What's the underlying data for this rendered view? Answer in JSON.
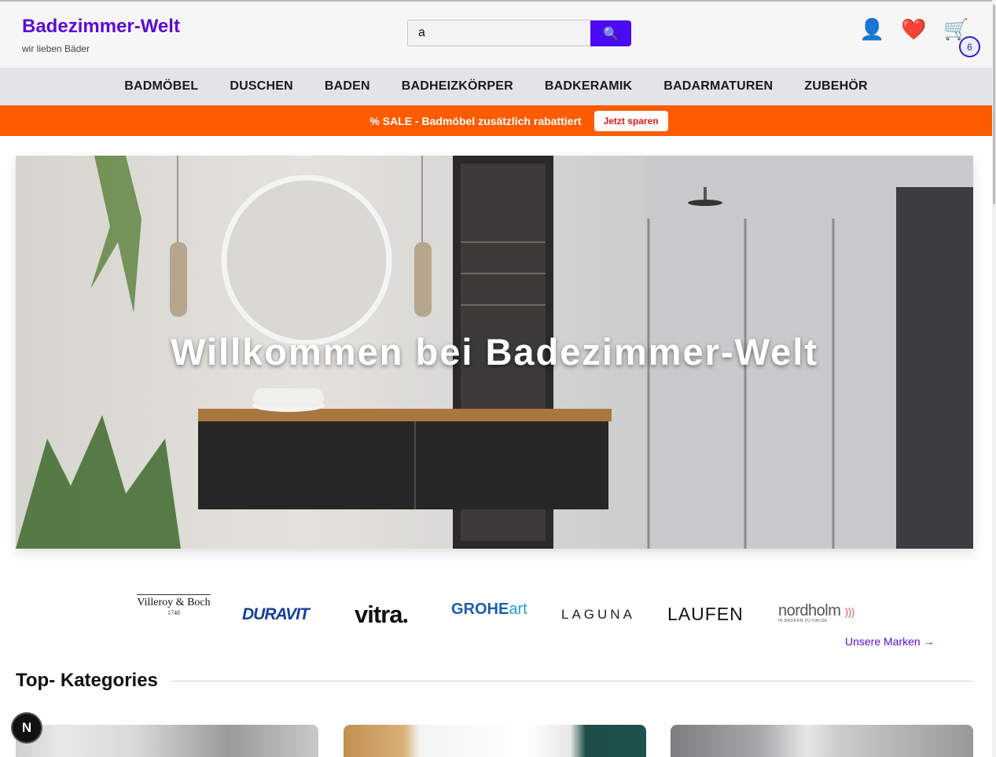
{
  "header": {
    "logo": "Badezimmer-Welt",
    "tagline": "wir lieben Bäder",
    "search_value": "a",
    "search_icon": "🔍",
    "user_icon": "👤",
    "wishlist_icon": "❤️",
    "cart_icon": "🛒",
    "cart_count": "6"
  },
  "nav": {
    "items": [
      "BADMÖBEL",
      "DUSCHEN",
      "BADEN",
      "BADHEIZKÖRPER",
      "BADKERAMIK",
      "BADARMATUREN",
      "ZUBEHÖR"
    ]
  },
  "sale": {
    "text": "% SALE - Badmöbel zusätzlich rabattiert",
    "button": "Jetzt sparen"
  },
  "hero": {
    "title": "Willkommen bei Badezimmer-Welt"
  },
  "brands": {
    "villeroy": "Villeroy & Boch",
    "villeroy_year": "1748",
    "duravit": "DURAVIT",
    "vitra": "vitra.",
    "grohe": "GROHE",
    "grohe_art": "art",
    "laguna": "LAGUNA",
    "laufen": "LAUFEN",
    "nordholm": "nordholm",
    "nordholm_sub": "IN BÄDERN ZU HAUSE",
    "all_link": "Unsere Marken →"
  },
  "categories": {
    "title": "Top- Kategories"
  },
  "next_badge": "N",
  "colors": {
    "brand_purple": "#5b0bd8",
    "search_button": "#4b0bf4",
    "sale_orange": "#ff5b00",
    "sale_button_text": "#e31616"
  }
}
